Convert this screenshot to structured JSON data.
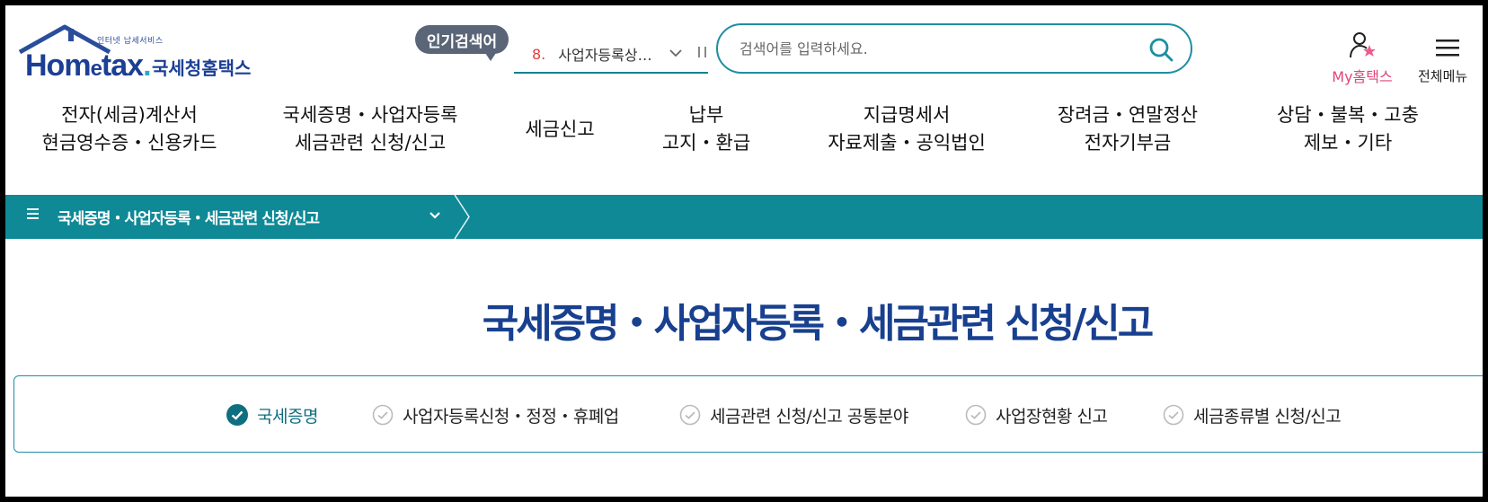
{
  "header": {
    "logo_small": "인터넷 납세서비스",
    "logo_brand_home": "Hom",
    "logo_brand_e": "e",
    "logo_brand_tax": "tax",
    "logo_brand_dot": ".",
    "logo_korean": "국세청홈택스",
    "popular_label": "인기검색어",
    "popular_rank": "8.",
    "popular_word": "사업자등록상…",
    "search_placeholder": "검색어를 입력하세요.",
    "my_hometax": "My홈택스",
    "all_menu": "전체메뉴"
  },
  "main_nav": [
    {
      "line1": "전자(세금)계산서",
      "line2": "현금영수증・신용카드"
    },
    {
      "line1": "국세증명・사업자등록",
      "line2": "세금관련 신청/신고"
    },
    {
      "line1": "세금신고",
      "line2": ""
    },
    {
      "line1": "납부",
      "line2": "고지・환급"
    },
    {
      "line1": "지급명세서",
      "line2": "자료제출・공익법인"
    },
    {
      "line1": "장려금・연말정산",
      "line2": "전자기부금"
    },
    {
      "line1": "상담・불복・고충",
      "line2": "제보・기타"
    }
  ],
  "breadcrumb": {
    "label": "국세증명・사업자등록・세금관련 신청/신고"
  },
  "page_title": "국세증명・사업자등록・세금관련 신청/신고",
  "tabs": [
    {
      "label": "국세증명",
      "active": true
    },
    {
      "label": "사업자등록신청・정정・휴폐업",
      "active": false
    },
    {
      "label": "세금관련 신청/신고 공통분야",
      "active": false
    },
    {
      "label": "사업장현황 신고",
      "active": false
    },
    {
      "label": "세금종류별 신청/신고",
      "active": false
    }
  ],
  "colors": {
    "brand_blue": "#1b3f94",
    "teal": "#0f8996",
    "accent_pink": "#e0457b",
    "rank_red": "#e33d3d"
  }
}
